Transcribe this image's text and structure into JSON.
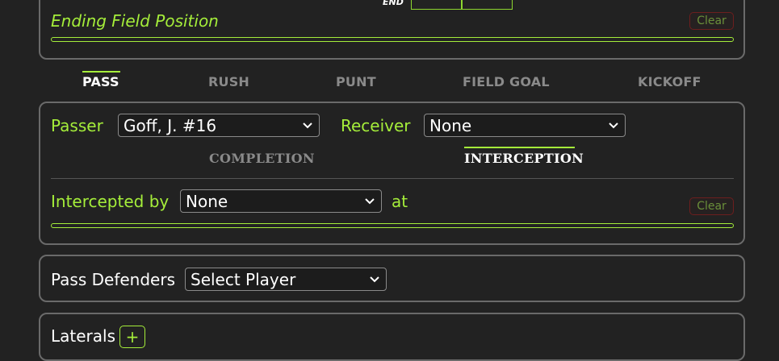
{
  "ending_field": {
    "end_label": "END",
    "title": "Ending Field Position",
    "clear_label": "Clear"
  },
  "play_tabs": [
    {
      "label": "PASS",
      "active": true
    },
    {
      "label": "RUSH",
      "active": false
    },
    {
      "label": "PUNT",
      "active": false
    },
    {
      "label": "FIELD GOAL",
      "active": false
    },
    {
      "label": "KICKOFF",
      "active": false
    }
  ],
  "pass": {
    "passer_label": "Passer",
    "passer_value": "Goff, J. #16",
    "receiver_label": "Receiver",
    "receiver_value": "None",
    "result_tabs": [
      {
        "label": "COMPLETION",
        "active": false
      },
      {
        "label": "INTERCEPTION",
        "active": true
      }
    ],
    "intercepted_by_label": "Intercepted by",
    "intercepted_by_value": "None",
    "at_label": "at",
    "clear_label": "Clear"
  },
  "pass_defenders": {
    "label": "Pass Defenders",
    "select_value": "Select Player"
  },
  "laterals": {
    "label": "Laterals",
    "add_label": "+"
  },
  "colors": {
    "accent": "#a5ee3a",
    "background": "#222222",
    "border": "#6a6a6a",
    "clear_border": "#6d1e1e"
  }
}
